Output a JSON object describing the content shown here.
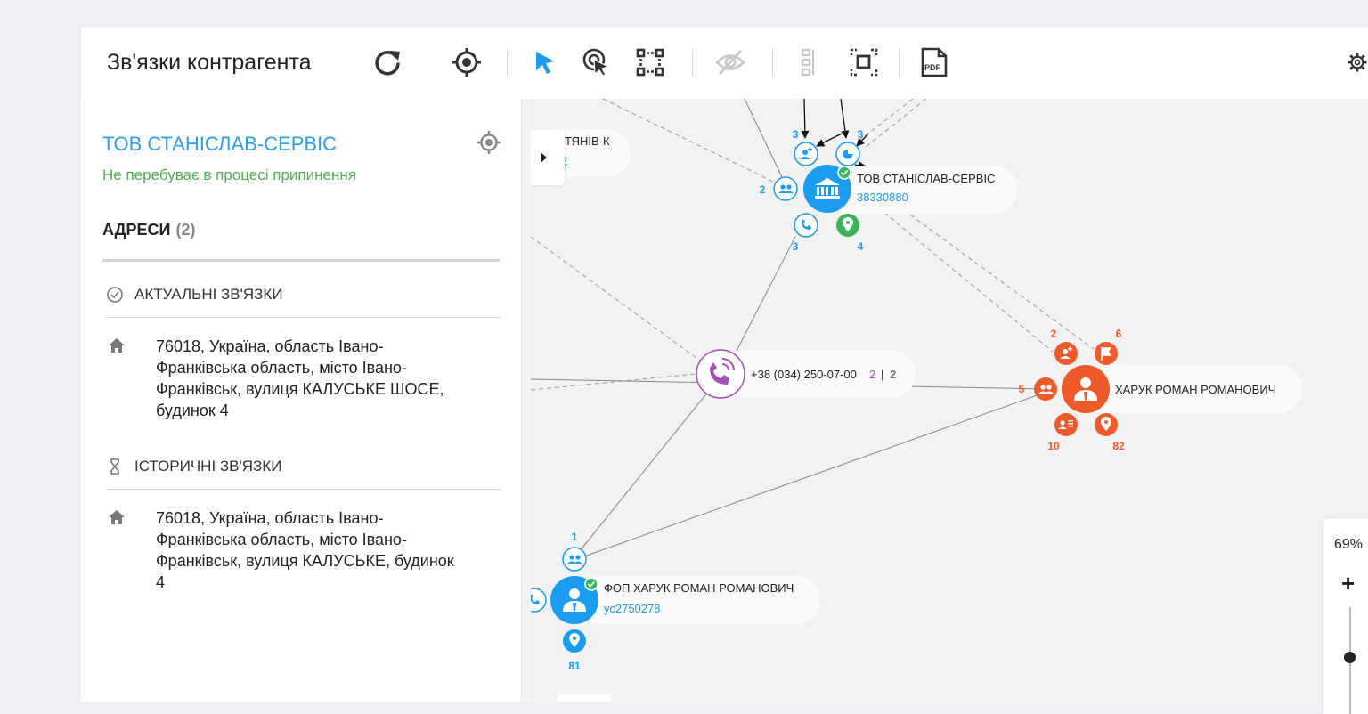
{
  "toolbar": {
    "title": "Зв'язки контрагента",
    "buttons": [
      "refresh-icon",
      "target-icon",
      "pointer-icon",
      "click-select-icon",
      "rect-select-icon",
      "hide-icon",
      "tree-layout-icon",
      "fit-icon",
      "pdf-icon",
      "settings-icon"
    ],
    "pdf_label": "PDF"
  },
  "panel": {
    "company_name": "ТОВ СТАНІСЛАВ-СЕРВІС",
    "company_status": "Не перебуває в процесі припинення",
    "section_title": "АДРЕСИ",
    "section_count": "(2)",
    "groups": [
      {
        "title": "АКТУАЛЬНІ ЗВ'ЯЗКИ",
        "address": "76018, Україна, область Івано-Франківська область, місто Івано-Франківськ, вулиця КАЛУСЬКЕ ШОСЕ, будинок 4"
      },
      {
        "title": "ІСТОРИЧНІ ЗВ'ЯЗКИ",
        "address": "76018, Україна, область Івано-Франківська область, місто Івано-Франківськ, вулиця КАЛУСЬКЕ, будинок 4"
      }
    ]
  },
  "graph": {
    "colors": {
      "blue": "#1a9cf0",
      "orange": "#ef5a2b",
      "purple": "#a64fb8",
      "green": "#3cb55a"
    },
    "partial_node": {
      "label": "ТЯНІВ-К",
      "code": "2"
    },
    "company_node": {
      "name": "ТОВ СТАНІСЛАВ-СЕРВІС",
      "code": "38330880",
      "badges": {
        "top_left": "3",
        "top_right": "3",
        "left": "2",
        "bottom_left": "3",
        "bottom_right": "4"
      }
    },
    "phone_node": {
      "label": "+38 (034) 250-07-00",
      "count_a": "2",
      "sep": "|",
      "count_b": "2"
    },
    "person_node": {
      "name": "ХАРУК РОМАН РОМАНОВИЧ",
      "badges": {
        "top_left": "2",
        "top_right": "6",
        "left": "5",
        "bottom_left": "10",
        "bottom_right": "82"
      }
    },
    "fop_node": {
      "name": "ФОП ХАРУК РОМАН РОМАНОВИЧ",
      "code": "ус2750278",
      "badges": {
        "top": "1",
        "bottom": "81"
      }
    }
  },
  "zoom": {
    "percent": "69%",
    "plus": "+"
  }
}
